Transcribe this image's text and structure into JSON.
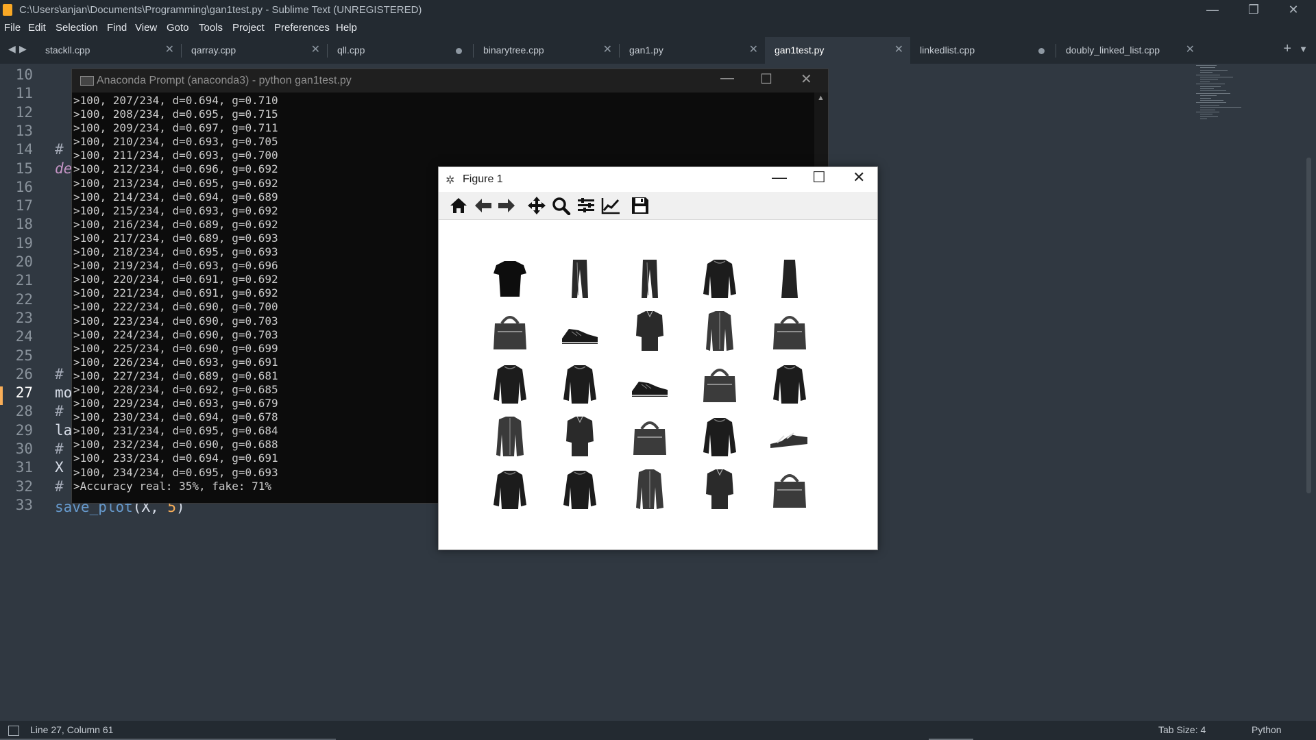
{
  "window": {
    "title": "C:\\Users\\anjan\\Documents\\Programming\\gan1test.py - Sublime Text (UNREGISTERED)",
    "controls": [
      "—",
      "❐",
      "✕"
    ]
  },
  "menu": [
    "File",
    "Edit",
    "Selection",
    "Find",
    "View",
    "Goto",
    "Tools",
    "Project",
    "Preferences",
    "Help"
  ],
  "tabs": [
    {
      "label": "stackll.cpp",
      "state": "close"
    },
    {
      "label": "qarray.cpp",
      "state": "close"
    },
    {
      "label": "qll.cpp",
      "state": "modified"
    },
    {
      "label": "binarytree.cpp",
      "state": "close"
    },
    {
      "label": "gan1.py",
      "state": "close"
    },
    {
      "label": "gan1test.py",
      "state": "close",
      "active": true
    },
    {
      "label": "linkedlist.cpp",
      "state": "modified"
    },
    {
      "label": "doubly_linked_list.cpp",
      "state": "close"
    }
  ],
  "tab_glyphs": {
    "close": "✕",
    "plus": "+",
    "more": "▼",
    "prev": "◀",
    "next": "▶"
  },
  "editor": {
    "line_numbers": [
      "10",
      "11",
      "12",
      "13",
      "14",
      "15",
      "16",
      "17",
      "18",
      "19",
      "20",
      "21",
      "22",
      "23",
      "24",
      "25",
      "26",
      "27",
      "28",
      "29",
      "30",
      "31",
      "32",
      "33"
    ],
    "current_line": "27",
    "visible_code": [
      {
        "line": "14",
        "text": "#",
        "style": "comment"
      },
      {
        "line": "15",
        "text": "de",
        "style": "keyword"
      },
      {
        "line": "26",
        "text": "#",
        "style": "comment"
      },
      {
        "line": "27",
        "text": "mo",
        "style": "plain"
      },
      {
        "line": "28",
        "text": "#",
        "style": "comment"
      },
      {
        "line": "29",
        "text": "la",
        "style": "plain"
      },
      {
        "line": "30",
        "text": "#",
        "style": "comment"
      },
      {
        "line": "31",
        "text": "X",
        "style": "plain"
      },
      {
        "line": "32",
        "text": "#",
        "style": "comment"
      }
    ],
    "line33": {
      "fn": "save_plot",
      "open": "(X, ",
      "num": "5",
      "close": ")"
    }
  },
  "console": {
    "title": "Anaconda Prompt (anaconda3) - python  gan1test.py",
    "controls": [
      "—",
      "☐",
      "✕"
    ],
    "lines": [
      ">100, 207/234, d=0.694, g=0.710",
      ">100, 208/234, d=0.695, g=0.715",
      ">100, 209/234, d=0.697, g=0.711",
      ">100, 210/234, d=0.693, g=0.705",
      ">100, 211/234, d=0.693, g=0.700",
      ">100, 212/234, d=0.696, g=0.692",
      ">100, 213/234, d=0.695, g=0.692",
      ">100, 214/234, d=0.694, g=0.689",
      ">100, 215/234, d=0.693, g=0.692",
      ">100, 216/234, d=0.689, g=0.692",
      ">100, 217/234, d=0.689, g=0.693",
      ">100, 218/234, d=0.695, g=0.693",
      ">100, 219/234, d=0.693, g=0.696",
      ">100, 220/234, d=0.691, g=0.692",
      ">100, 221/234, d=0.691, g=0.692",
      ">100, 222/234, d=0.690, g=0.700",
      ">100, 223/234, d=0.690, g=0.703",
      ">100, 224/234, d=0.690, g=0.703",
      ">100, 225/234, d=0.690, g=0.699",
      ">100, 226/234, d=0.693, g=0.691",
      ">100, 227/234, d=0.689, g=0.681",
      ">100, 228/234, d=0.692, g=0.685",
      ">100, 229/234, d=0.693, g=0.679",
      ">100, 230/234, d=0.694, g=0.678",
      ">100, 231/234, d=0.695, g=0.684",
      ">100, 232/234, d=0.690, g=0.688",
      ">100, 233/234, d=0.694, g=0.691",
      ">100, 234/234, d=0.695, g=0.693",
      ">Accuracy real: 35%, fake: 71%"
    ]
  },
  "figure": {
    "title": "Figure 1",
    "controls": [
      "—",
      "☐",
      "✕"
    ],
    "toolbar": [
      "home-icon",
      "back-arrow-icon",
      "forward-arrow-icon",
      "pan-icon",
      "zoom-icon",
      "subplots-icon",
      "edit-curve-icon",
      "save-icon"
    ],
    "grid_rows": 5,
    "grid_cols": 5,
    "images": [
      "tshirt",
      "trouser",
      "trouser",
      "pullover",
      "dress",
      "bag",
      "sneaker",
      "shirt",
      "coat",
      "bag",
      "pullover",
      "pullover",
      "sneaker",
      "bag",
      "pullover",
      "coat",
      "shirt",
      "bag",
      "pullover",
      "sandal",
      "pullover",
      "pullover",
      "coat",
      "shirt",
      "bag"
    ]
  },
  "status": {
    "position": "Line 27, Column 61",
    "tab_size": "Tab Size: 4",
    "syntax": "Python"
  },
  "colors": {
    "editor_bg": "#303841",
    "chrome_bg": "#232a31",
    "accent_orange": "#f9ae58",
    "function_blue": "#6699cc",
    "keyword_purple": "#c695c6"
  }
}
